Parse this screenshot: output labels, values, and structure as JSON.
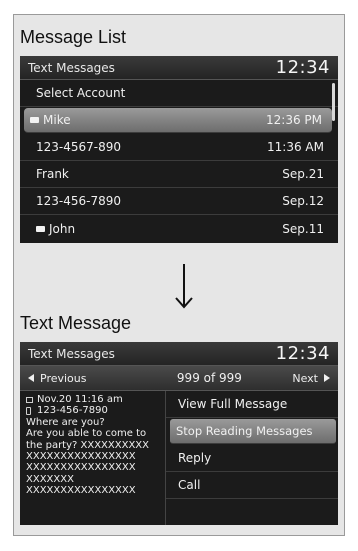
{
  "section1": {
    "title": "Message List"
  },
  "screen1": {
    "header_title": "Text Messages",
    "clock": "12:34",
    "rows": [
      {
        "name": "Select Account",
        "time": "",
        "envelope": false,
        "selected": false
      },
      {
        "name": "Mike",
        "time": "12:36 PM",
        "envelope": true,
        "selected": true
      },
      {
        "name": "123-4567-890",
        "time": "11:36 AM",
        "envelope": false,
        "selected": false
      },
      {
        "name": "Frank",
        "time": "Sep.21",
        "envelope": false,
        "selected": false
      },
      {
        "name": "123-456-7890",
        "time": "Sep.12",
        "envelope": false,
        "selected": false
      },
      {
        "name": "John",
        "time": "Sep.11",
        "envelope": true,
        "selected": false
      }
    ]
  },
  "section2": {
    "title": "Text Message"
  },
  "screen2": {
    "header_title": "Text Messages",
    "clock": "12:34",
    "nav": {
      "previous": "Previous",
      "counter": "999 of 999",
      "next": "Next"
    },
    "message": {
      "date": "Nov.20 11:16 am",
      "number": "123-456-7890",
      "lines": [
        "Where are you?",
        "Are you able to come to",
        "the party? XXXXXXXXXX",
        "XXXXXXXXXXXXXXXX",
        "XXXXXXXXXXXXXXXX",
        "XXXXXXX",
        "XXXXXXXXXXXXXXXX"
      ]
    },
    "actions": [
      {
        "label": "View Full Message",
        "selected": false
      },
      {
        "label": "Stop Reading Messages",
        "selected": true
      },
      {
        "label": "Reply",
        "selected": false
      },
      {
        "label": "Call",
        "selected": false
      }
    ]
  }
}
